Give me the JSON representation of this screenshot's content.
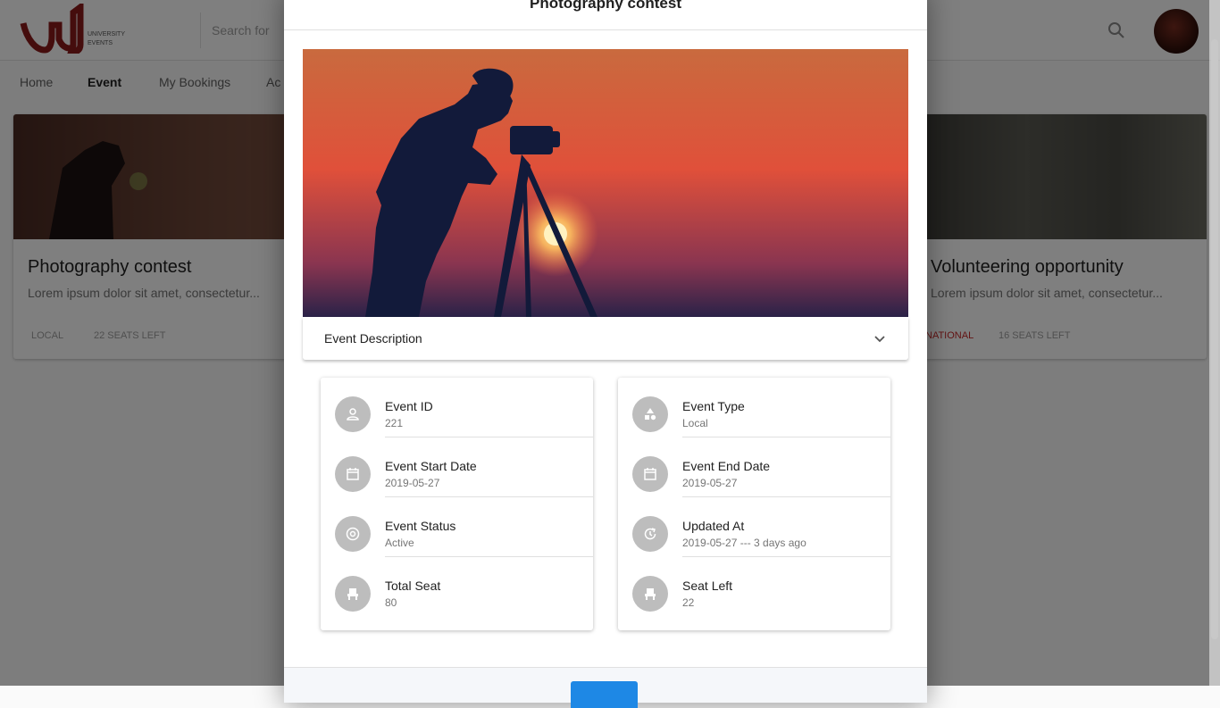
{
  "background": {
    "search_placeholder": "Search for",
    "nav": [
      "Home",
      "Event",
      "My Bookings",
      "Ac"
    ],
    "cards": [
      {
        "title": "Photography contest",
        "desc": "Lorem ipsum dolor sit amet, consectetur...",
        "tag": "Local",
        "seats": "22 seats left"
      },
      {
        "title": "Volunteering opportunity",
        "desc": "Lorem ipsum dolor sit amet, consectetur...",
        "tag": "National",
        "seats": "16 seats left"
      }
    ]
  },
  "dialog": {
    "title": "Photography contest",
    "description_label": "Event Description",
    "left": [
      {
        "icon": "person-icon",
        "label": "Event ID",
        "value": "221"
      },
      {
        "icon": "calendar-icon",
        "label": "Event Start Date",
        "value": "2019-05-27"
      },
      {
        "icon": "at-sign-icon",
        "label": "Event Status",
        "value": "Active"
      },
      {
        "icon": "seat-icon",
        "label": "Total Seat",
        "value": "80"
      }
    ],
    "right": [
      {
        "icon": "category-shapes-icon",
        "label": "Event Type",
        "value": "Local"
      },
      {
        "icon": "calendar-icon",
        "label": "Event End Date",
        "value": "2019-05-27"
      },
      {
        "icon": "update-icon",
        "label": "Updated At",
        "value": "2019-05-27 --- 3 days ago"
      },
      {
        "icon": "seat-icon",
        "label": "Seat Left",
        "value": "22"
      }
    ]
  },
  "colors": {
    "accent": "#1e88e5",
    "icon_bg": "#bdbdbd",
    "overlay": "rgba(0,0,0,0.5)"
  }
}
